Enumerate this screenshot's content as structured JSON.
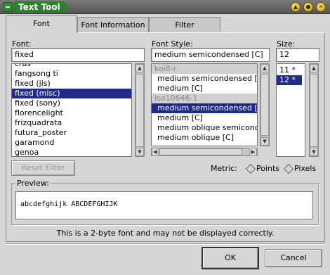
{
  "window": {
    "title": "Text Tool"
  },
  "tabs": [
    {
      "label": "Font",
      "active": true
    },
    {
      "label": "Font Information",
      "active": false
    },
    {
      "label": "Filter",
      "active": false
    }
  ],
  "font": {
    "label": "Font:",
    "value": "fixed",
    "items": [
      "cras",
      "fangsong ti",
      "fixed (jis)",
      "fixed (misc)",
      "fixed (sony)",
      "florencelight",
      "frizquadrata",
      "futura_poster",
      "garamond",
      "genoa"
    ],
    "selected": "fixed (misc)"
  },
  "style": {
    "label": "Font Style:",
    "value": "medium semicondensed [C]",
    "items": [
      {
        "text": "koi8-r",
        "kind": "header"
      },
      {
        "text": "medium semicondensed [C]",
        "kind": "item"
      },
      {
        "text": "medium [C]",
        "kind": "item"
      },
      {
        "text": "iso10646-1",
        "kind": "header"
      },
      {
        "text": "medium semicondensed [C]",
        "kind": "selected"
      },
      {
        "text": "medium [C]",
        "kind": "item"
      },
      {
        "text": "medium oblique semicondensed",
        "kind": "item"
      },
      {
        "text": "medium oblique [C]",
        "kind": "item"
      }
    ]
  },
  "size": {
    "label": "Size:",
    "value": "12",
    "items": [
      "11 *",
      "12 *"
    ],
    "selected": "12 *"
  },
  "reset_filter": "Reset Filter",
  "metric": {
    "label": "Metric:",
    "options": [
      "Points",
      "Pixels"
    ]
  },
  "preview": {
    "label": "Preview:",
    "text": "abcdefghijk ABCDEFGHIJK"
  },
  "note": "This is a 2-byte font and may not be displayed correctly.",
  "buttons": {
    "ok": "OK",
    "cancel": "Cancel"
  },
  "colors": {
    "selection": "#1f2a8a",
    "titlebar_accent": "#2f7d2f"
  }
}
